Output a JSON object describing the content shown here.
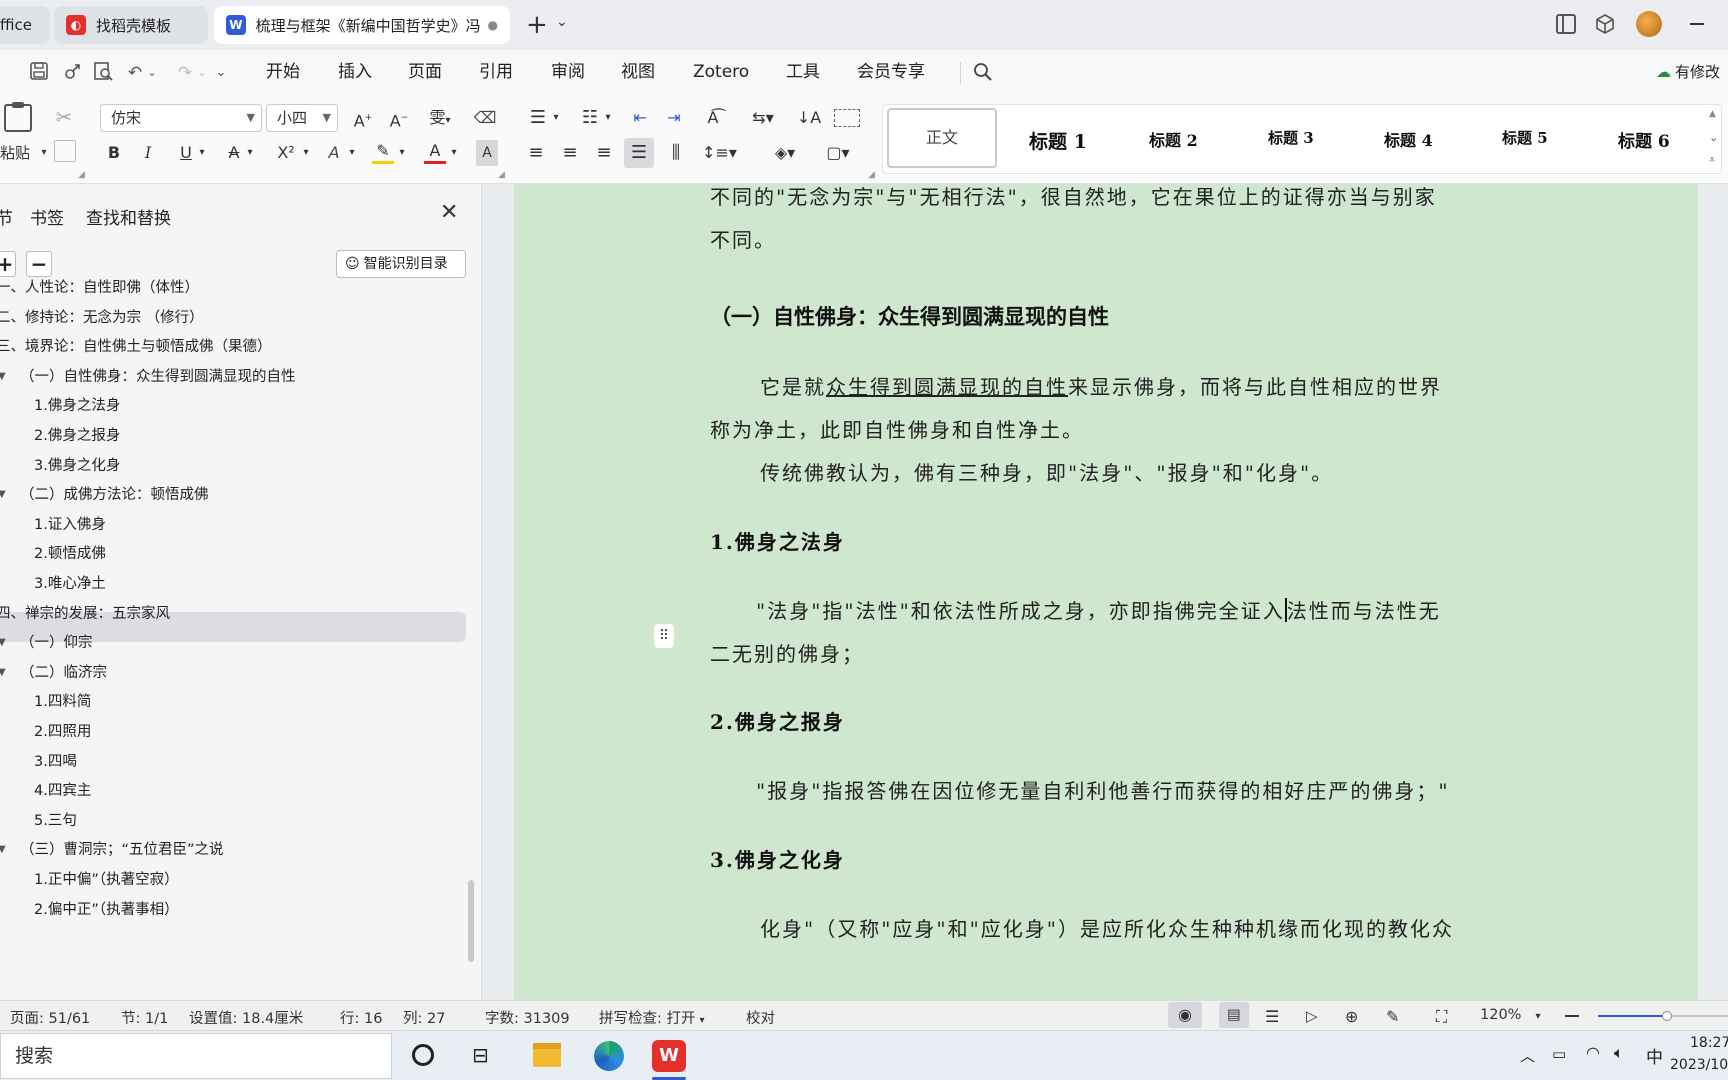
{
  "tabs": [
    {
      "label": "ffice"
    },
    {
      "label": "找稻壳模板",
      "icon": "docer-icon"
    },
    {
      "label": "梳理与框架《新编中国哲学史》冯.",
      "icon": "word-doc-icon",
      "dot": "●"
    }
  ],
  "tabbar": {
    "new_tab": "+",
    "chevron": "⌄"
  },
  "menu": {
    "items": [
      "开始",
      "插入",
      "页面",
      "引用",
      "审阅",
      "视图",
      "Zotero",
      "工具",
      "会员专享"
    ],
    "active": "开始",
    "modified": "有修改"
  },
  "ribbon": {
    "font_name": "仿宋",
    "font_size": "小四",
    "paste": "粘贴",
    "bold": "B",
    "italic": "I",
    "underline": "U",
    "strike": "A",
    "superscript": "X²",
    "text_effect": "A",
    "font_color": "A",
    "char_shade": "A"
  },
  "styles": [
    "正文",
    "标题 1",
    "标题 2",
    "标题 3",
    "标题 4",
    "标题 5",
    "标题 6"
  ],
  "sidebar": {
    "tabs": [
      "节",
      "书签",
      "查找和替换"
    ],
    "smart_toc": "智能识别目录",
    "plus": "+",
    "minus": "−",
    "items": [
      {
        "text": "一、人性论：自性即佛（体性）",
        "level": 0
      },
      {
        "text": "二、修持论：无念为宗 （修行）",
        "level": 0
      },
      {
        "text": "三、境界论：自性佛土与顿悟成佛（果德）",
        "level": 0
      },
      {
        "text": "（一）自性佛身：众生得到圆满显现的自性",
        "level": 1
      },
      {
        "text": "1.佛身之法身",
        "level": 2,
        "selected": true
      },
      {
        "text": "2.佛身之报身",
        "level": 2
      },
      {
        "text": "3.佛身之化身",
        "level": 2
      },
      {
        "text": "（二）成佛方法论：顿悟成佛",
        "level": 1
      },
      {
        "text": "1.证入佛身",
        "level": 2
      },
      {
        "text": "2.顿悟成佛",
        "level": 2
      },
      {
        "text": "3.唯心净土",
        "level": 2
      },
      {
        "text": "四、禅宗的发展：五宗家风",
        "level": 0
      },
      {
        "text": "（一）仰宗",
        "level": 1
      },
      {
        "text": "（二）临济宗",
        "level": 1
      },
      {
        "text": "1.四料简",
        "level": 2
      },
      {
        "text": "2.四照用",
        "level": 2
      },
      {
        "text": "3.四喝",
        "level": 2
      },
      {
        "text": "4.四宾主",
        "level": 2
      },
      {
        "text": "5.三句",
        "level": 2
      },
      {
        "text": "（三）曹洞宗；“五位君臣”之说",
        "level": 1
      },
      {
        "text": "1.正中偏”（执著空寂）",
        "level": 2
      },
      {
        "text": "2.偏中正”（执著事相）",
        "level": 2
      }
    ]
  },
  "document": {
    "p0a": "不同的\"无念为宗\"与\"无相行法\"，很自然地，它在果位上的证得亦当与别家",
    "p0b": "不同。",
    "h_section": "（一）自性佛身：众生得到圆满显现的自性",
    "p1a_pre": "它是就",
    "p1a_u": "众生得到圆满显现的自性",
    "p1a_post": "来显示佛身，而将与此自性相应的世界",
    "p1b": "称为净土，此即自性佛身和自性净土。",
    "p2": "传统佛教认为，佛有三种身，即\"法身\"、\"报身\"和\"化身\"。",
    "h1": "1.佛身之法身",
    "p3a_pre": "\"法身\"指\"法性\"和依法性所成之身，亦即指佛完全证入",
    "p3a_post": "法性而与法性无",
    "p3b": "二无别的佛身；",
    "h2": "2.佛身之报身",
    "p4": "\"报身\"指报答佛在因位修无量自利利他善行而获得的相好庄严的佛身；\"",
    "h3": "3.佛身之化身",
    "p5": "化身\"（又称\"应身\"和\"应化身\"）是应所化众生种种机缘而化现的教化众"
  },
  "status": {
    "page": "页面: 51/61",
    "section": "节: 1/1",
    "setting": "设置值: 18.4厘米",
    "row": "行: 16",
    "col": "列: 27",
    "words": "字数: 31309",
    "spell": "拼写检查: 打开",
    "proof": "校对",
    "zoom": "120%"
  },
  "taskbar": {
    "search": "搜索",
    "time": "18:27",
    "date": "2023/10",
    "ime": "中"
  },
  "colors": {
    "accent": "#2f5bd6",
    "page_bg": "#cfe6cf",
    "wps_red": "#e2312d"
  }
}
